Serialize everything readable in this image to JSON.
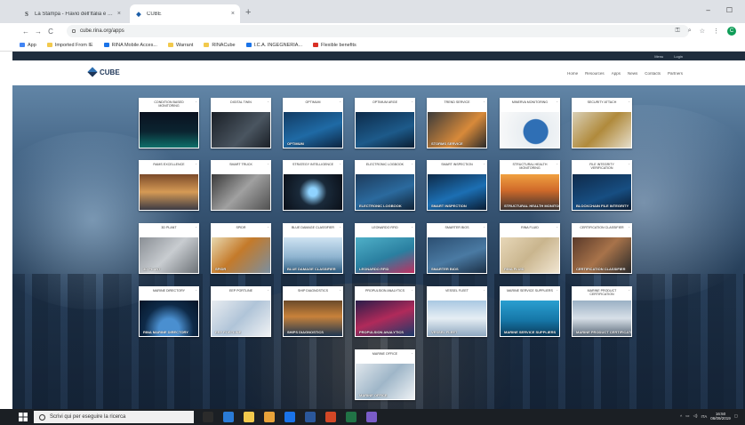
{
  "browser": {
    "tabs": [
      {
        "favicon_letter": "S",
        "title": "La Stampa - Flavio dell'Italia e de...",
        "close": "×"
      },
      {
        "favicon_letter": "◆",
        "title": "CUBE",
        "close": "×"
      }
    ],
    "new_tab": "+",
    "window_controls": [
      "–",
      "☐"
    ],
    "url": "cube.rina.org/apps",
    "nav": {
      "back": "←",
      "forward": "→",
      "reload": "C",
      "home": "⌂"
    },
    "profile_initial": "C",
    "bookmarks": [
      {
        "label": "App",
        "color": "#4285f4"
      },
      {
        "label": "Imported From IE",
        "color": "#f2c94c"
      },
      {
        "label": "RINA Mobile Acces...",
        "color": "#1a73e8"
      },
      {
        "label": "Warrant",
        "color": "#f2c94c"
      },
      {
        "label": "RINACube",
        "color": "#f2c94c"
      },
      {
        "label": "I.C.A. INGEGNERIA...",
        "color": "#1a73e8"
      },
      {
        "label": "Flexible benefits",
        "color": "#d93025"
      }
    ]
  },
  "site": {
    "top_links": [
      "Menu",
      "Login"
    ],
    "logo_text": "CUBE",
    "nav": [
      "Home",
      "Resources",
      "Apps",
      "News",
      "Contacts",
      "Partners"
    ]
  },
  "tiles": [
    {
      "label": "CONDITION BASED MONITORING",
      "brand": "",
      "img": "linear-gradient(180deg,#0b1220 0%,#0b2430 55%,#0e6f6a 100%)"
    },
    {
      "label": "DIGITAL TWIN",
      "brand": "",
      "img": "linear-gradient(135deg,#1a1f26,#4a5560 60%,#1a1f26)"
    },
    {
      "label": "OPTIMUM",
      "brand": "OPTIMUM",
      "img": "linear-gradient(160deg,#123b63,#1f6aa5 55%,#0c2440)"
    },
    {
      "label": "OPTIMUM ARGE",
      "brand": "",
      "img": "linear-gradient(160deg,#0d2b4a,#1d5a8a 60%,#0a1e33)"
    },
    {
      "label": "TREND SERVICE",
      "brand": "STORMS SERVICE",
      "img": "linear-gradient(135deg,#3a3a3a,#d88a3a 60%,#2a2a2a)"
    },
    {
      "label": "MINERVA MONITORING",
      "brand": "",
      "img": "radial-gradient(circle at 60% 55%,#2f6fb5 0 30%,#e9eef2 32%,#fafafa 100%)"
    },
    {
      "label": "SECURITY ATTACH",
      "brand": "",
      "img": "linear-gradient(135deg,#d9d0b8,#b08a3c 50%,#e6dfcc)"
    },
    {
      "label": "RAMS EXCELLENCE",
      "brand": "",
      "img": "linear-gradient(180deg,#7b4a2a,#d59a55 50%,#3b3a44)"
    },
    {
      "label": "SMART TRUCK",
      "brand": "",
      "img": "linear-gradient(135deg,#3a3a3a,#a0a0a0 50%,#505050)"
    },
    {
      "label": "STRATEGY INTELLIGENCE",
      "brand": "",
      "img": "radial-gradient(circle at 50% 50%,#8fd3ff 0 12%,#1a2a3a 40%,#0a0f18 100%)"
    },
    {
      "label": "ELECTRONIC LOGBOOK",
      "brand": "ELECTRONIC LOGBOOK",
      "img": "linear-gradient(160deg,#1d3b5c,#2b6a9e 55%,#102235)"
    },
    {
      "label": "SMART INSPECTION",
      "brand": "SMART INSPECTION",
      "img": "linear-gradient(160deg,#0e2a48,#1c6fb3 55%,#0a1d33)"
    },
    {
      "label": "STRUCTURAL HEALTH MONITORING",
      "brand": "STRUCTURAL HEALTH MONITORING",
      "img": "linear-gradient(180deg,#f0a040,#d06a2a 45%,#3a3230)"
    },
    {
      "label": "FILE INTEGRITY VERIFICATION",
      "brand": "BLOCKCHAIN FILE INTEGRITY",
      "img": "linear-gradient(160deg,#0f2a4a,#174e82 60%,#0a1a30)"
    },
    {
      "label": "3D PLANT",
      "brand": "3D PLANT",
      "img": "linear-gradient(135deg,#8a8f95,#c8ccd0 50%,#6d7277)"
    },
    {
      "label": "SPIDR",
      "brand": "SPIDR",
      "img": "linear-gradient(135deg,#e8d9b0,#c47a2a 45%,#7a8fa0)"
    },
    {
      "label": "BLUE DAMAGE CLASSIFIER",
      "brand": "BLUE DAMAGE CLASSIFIER",
      "img": "linear-gradient(180deg,#cfe3f2,#8fb4d0 55%,#2b5b80)"
    },
    {
      "label": "LEONARDO RFID",
      "brand": "LEONARDO RFID",
      "img": "linear-gradient(160deg,#4fb0c8,#2a7fa0 55%,#c03060)"
    },
    {
      "label": "SMARTER BIOS",
      "brand": "SMARTER BIOS",
      "img": "linear-gradient(160deg,#2c4f72,#4a7aa3 55%,#1b2f45)"
    },
    {
      "label": "RINA FLUID",
      "brand": "RINA FLUID",
      "img": "linear-gradient(135deg,#e7d7b8,#c9b58e 50%,#f1e6d2)"
    },
    {
      "label": "CERTIFICATION CLASSIFIER",
      "brand": "CERTIFICATION CLASSIFIER",
      "img": "linear-gradient(135deg,#5a3a2a,#a8734a 50%,#2a2a2a)"
    },
    {
      "label": "MARINE DIRECTORY",
      "brand": "RINA MARINE DIRECTORY",
      "img": "radial-gradient(circle at 50% 80%,#4a8fd0 0 25%,#0e2a48 60%,#061426 100%)"
    },
    {
      "label": "EEP PORTLINE",
      "brand": "EEP PORTLINE",
      "img": "linear-gradient(135deg,#e8ecf0,#b0c4d8 50%,#f0f2f4)"
    },
    {
      "label": "SHIP DIAGNOSTICS",
      "brand": "SHIPS DIAGNOSTICS",
      "img": "linear-gradient(180deg,#6a4a2a,#c8823a 45%,#1d3550)"
    },
    {
      "label": "PROPULSION ANALYTICS",
      "brand": "PROPULSION ANALYTICS",
      "img": "linear-gradient(160deg,#2a1d4a,#b02a5a 50%,#1a3a6a)"
    },
    {
      "label": "VESSEL FLEET",
      "brand": "VESSEL FLEET",
      "img": "linear-gradient(180deg,#a9c8e2,#e6eef4 50%,#8fa8c0)"
    },
    {
      "label": "MARINE SERVICE SUPPLIERS",
      "brand": "MARINE SERVICE SUPPLIERS",
      "img": "linear-gradient(180deg,#2a9fd0,#1677a8 55%,#0a3a5a)"
    },
    {
      "label": "MARINE PRODUCT CERTIFICATION",
      "brand": "MARINE PRODUCT CERTIFICATION",
      "img": "linear-gradient(180deg,#9ab0c4,#d8e0e8 50%,#5a6a7a)"
    },
    {
      "label": "MARINE OFFICE",
      "brand": "MARINE OFFICE",
      "img": "linear-gradient(135deg,#dfe6ec,#9fb6c8 50%,#eef2f5)"
    }
  ],
  "taskbar": {
    "search_placeholder": "Scrivi qui per eseguire la ricerca",
    "apps": [
      "#2b2b2b",
      "#2a7bd6",
      "#f2c94c",
      "#e8a33a",
      "#1a73e8",
      "#2b579a",
      "#d24726",
      "#217346",
      "#7a5cc7"
    ],
    "time": "16:50",
    "date": "06/09/2019",
    "lang": "ITA"
  }
}
